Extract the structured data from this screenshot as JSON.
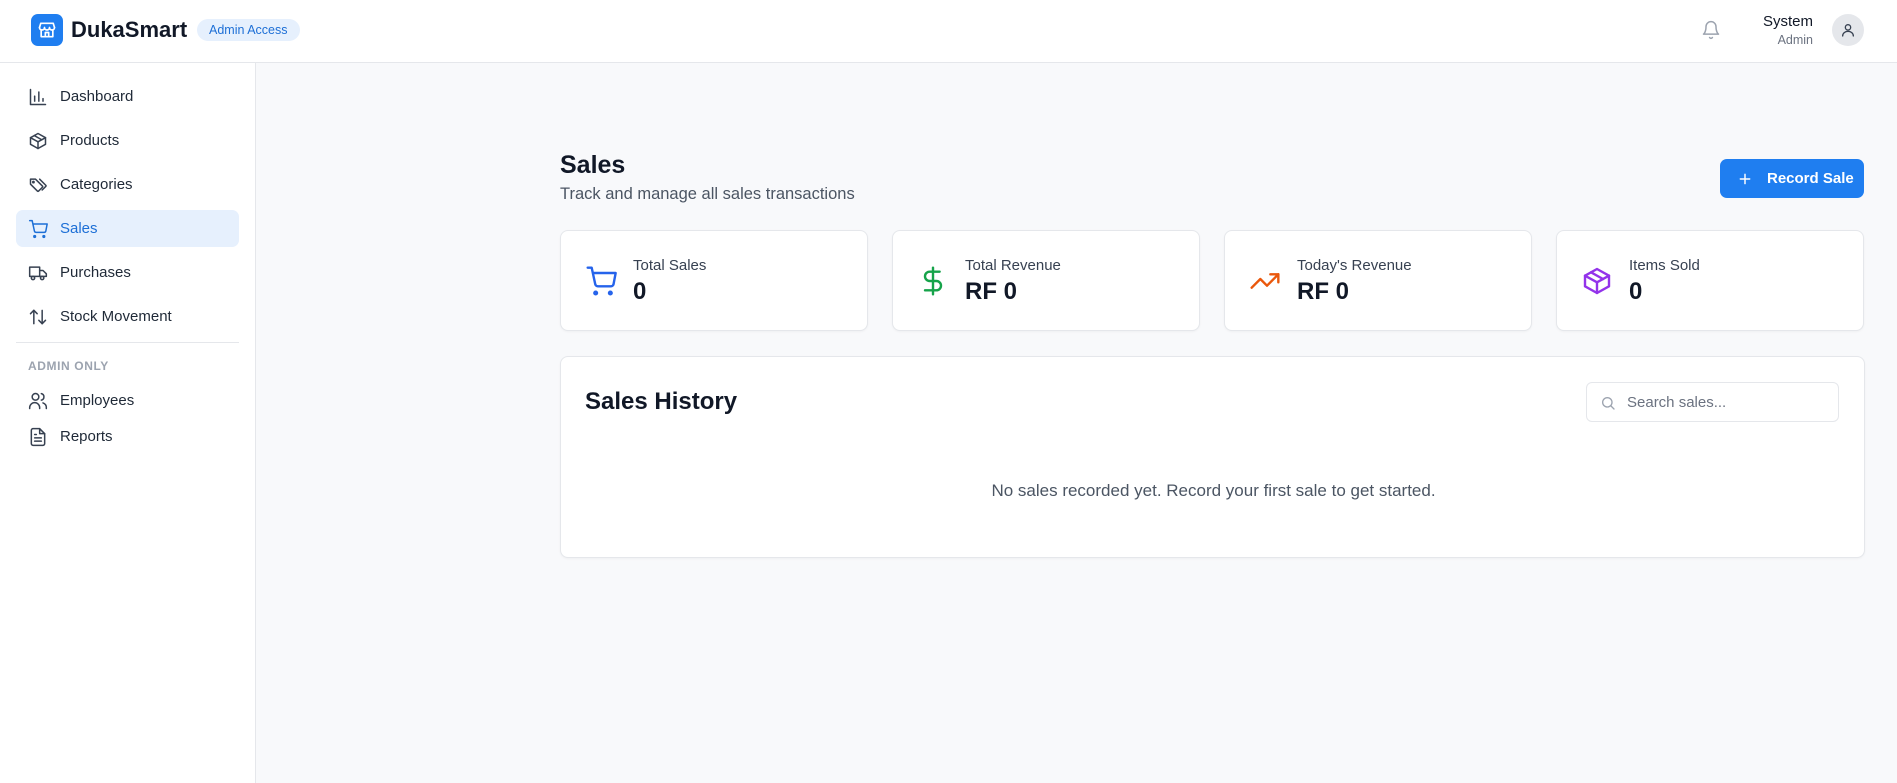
{
  "header": {
    "app_title": "DukaSmart",
    "badge": "Admin Access",
    "user_name": "System",
    "user_role": "Admin"
  },
  "sidebar": {
    "items": [
      {
        "label": "Dashboard",
        "icon": "bar-chart-icon"
      },
      {
        "label": "Products",
        "icon": "box-icon"
      },
      {
        "label": "Categories",
        "icon": "tags-icon"
      },
      {
        "label": "Sales",
        "icon": "cart-icon",
        "active": true
      },
      {
        "label": "Purchases",
        "icon": "truck-icon"
      },
      {
        "label": "Stock Movement",
        "icon": "arrows-up-down-icon"
      }
    ],
    "section_label": "ADMIN ONLY",
    "admin_items": [
      {
        "label": "Employees",
        "icon": "users-icon"
      },
      {
        "label": "Reports",
        "icon": "file-text-icon"
      }
    ]
  },
  "main": {
    "title": "Sales",
    "subtitle": "Track and manage all sales transactions",
    "record_button": "Record Sale",
    "stats": [
      {
        "label": "Total Sales",
        "value": "0",
        "icon": "cart-icon",
        "color": "#2563eb"
      },
      {
        "label": "Total Revenue",
        "value": "RF 0",
        "icon": "dollar-icon",
        "color": "#16a34a"
      },
      {
        "label": "Today's Revenue",
        "value": "RF 0",
        "icon": "trending-up-icon",
        "color": "#ea580c"
      },
      {
        "label": "Items Sold",
        "value": "0",
        "icon": "package-icon",
        "color": "#9333ea"
      }
    ],
    "history": {
      "title": "Sales History",
      "search_placeholder": "Search sales...",
      "search_value": "",
      "empty_message": "No sales recorded yet. Record your first sale to get started."
    }
  },
  "colors": {
    "primary": "#1f7ef0",
    "active_bg": "#e6f0fd",
    "page_bg": "#f8f9fb"
  }
}
